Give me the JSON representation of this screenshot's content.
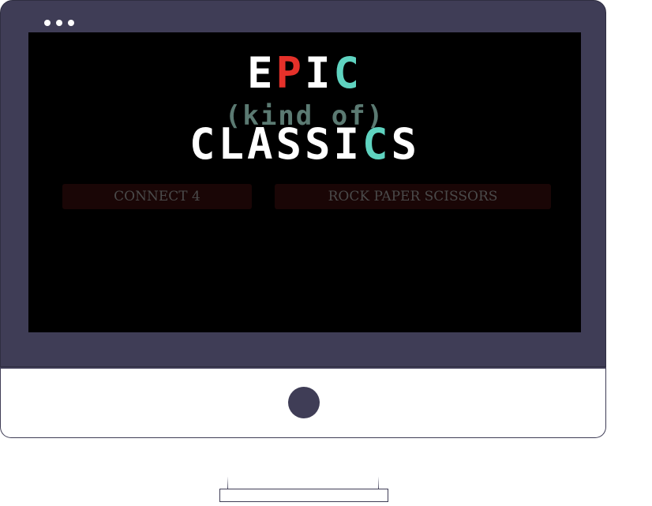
{
  "title": {
    "line1": [
      "E",
      "P",
      "I",
      "C"
    ],
    "line2": "(kind of)",
    "line3": [
      "C",
      "L",
      "A",
      "S",
      "S",
      "I",
      "C",
      "S"
    ]
  },
  "games": {
    "connect4_label": "CONNECT 4",
    "rps_label": "ROCK PAPER SCISSORS"
  },
  "colors": {
    "frame": "#3f3d56",
    "screen": "#000000",
    "accent_red": "#e5312a",
    "accent_teal": "#5fd3c0",
    "button_bg": "#1a0606"
  }
}
